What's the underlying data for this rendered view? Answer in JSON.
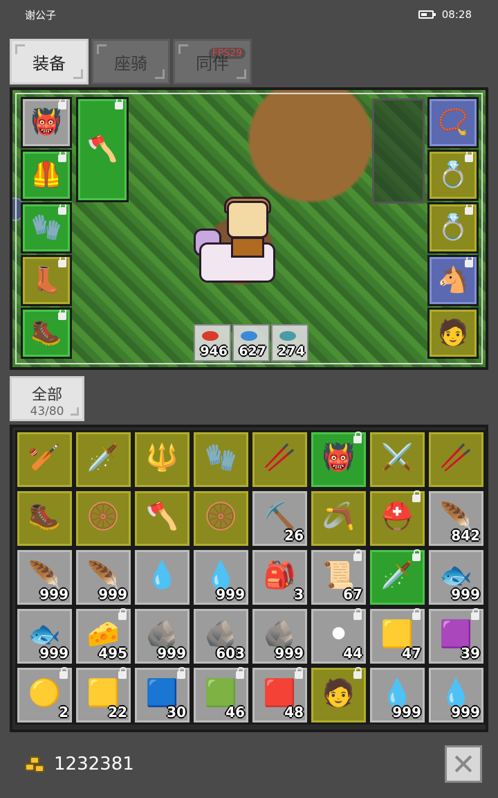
{
  "status_bar": {
    "title": "谢公子",
    "time": "08:28",
    "battery_icon": "battery-icon"
  },
  "tabs": [
    {
      "label": "装备",
      "active": true
    },
    {
      "label": "座骑",
      "active": false
    },
    {
      "label": "同伴",
      "active": false
    }
  ],
  "fps_label": "FPS29",
  "equipment_left": [
    {
      "name": "horned-helmet",
      "icon": "👹",
      "color": "gray",
      "locked": true
    },
    {
      "name": "brown-armor",
      "icon": "🦺",
      "color": "green",
      "locked": true
    },
    {
      "name": "purple-gloves",
      "icon": "🧤",
      "color": "green",
      "locked": true
    },
    {
      "name": "red-boots",
      "icon": "👢",
      "color": "yellow",
      "locked": true
    },
    {
      "name": "dark-boots",
      "icon": "🥾",
      "color": "green",
      "locked": true
    }
  ],
  "weapon_slot": {
    "name": "golden-axe",
    "icon": "🪓",
    "color": "green",
    "locked": true
  },
  "equipment_right": [
    {
      "name": "silver-amulet",
      "icon": "📿",
      "color": "blue",
      "locked": false
    },
    {
      "name": "gold-ring-1",
      "icon": "💍",
      "color": "yellow",
      "locked": true
    },
    {
      "name": "gold-ring-2",
      "icon": "💍",
      "color": "yellow",
      "locked": true
    },
    {
      "name": "horse-mount",
      "icon": "🐴",
      "color": "blue",
      "locked": true
    },
    {
      "name": "companion-portrait",
      "icon": "🧑",
      "color": "yellow",
      "locked": false
    }
  ],
  "scene_resources": [
    {
      "count": "946",
      "color": "#d93a2a"
    },
    {
      "count": "627",
      "color": "#3a8ad9"
    },
    {
      "count": "274",
      "color": "#4a9aa8"
    }
  ],
  "filter": {
    "label": "全部",
    "count": "43/80"
  },
  "inventory": [
    {
      "icon": "🏏",
      "color": "yellow",
      "count": "",
      "locked": false
    },
    {
      "icon": "🗡️",
      "color": "yellow",
      "count": "",
      "locked": false
    },
    {
      "icon": "🔱",
      "color": "yellow",
      "count": "",
      "locked": false
    },
    {
      "icon": "🧤",
      "color": "yellow",
      "count": "",
      "locked": false
    },
    {
      "icon": "🥢",
      "color": "yellow",
      "count": "",
      "locked": false
    },
    {
      "icon": "👹",
      "color": "green",
      "count": "",
      "locked": true
    },
    {
      "icon": "⚔️",
      "color": "yellow",
      "count": "",
      "locked": false
    },
    {
      "icon": "🥢",
      "color": "yellow",
      "count": "",
      "locked": false
    },
    {
      "icon": "🥾",
      "color": "yellow",
      "count": "",
      "locked": false
    },
    {
      "icon": "🛞",
      "color": "yellow",
      "count": "",
      "locked": false
    },
    {
      "icon": "🪓",
      "color": "yellow",
      "count": "",
      "locked": false
    },
    {
      "icon": "🛞",
      "color": "yellow",
      "count": "",
      "locked": false
    },
    {
      "icon": "⛏️",
      "color": "gray",
      "count": "26",
      "locked": false
    },
    {
      "icon": "🪃",
      "color": "yellow",
      "count": "",
      "locked": false
    },
    {
      "icon": "⛑️",
      "color": "yellow",
      "count": "",
      "locked": true
    },
    {
      "icon": "🪶",
      "color": "gray",
      "count": "842",
      "locked": false
    },
    {
      "icon": "🪶",
      "color": "gray",
      "count": "999",
      "locked": false
    },
    {
      "icon": "🪶",
      "color": "gray",
      "count": "999",
      "locked": false
    },
    {
      "icon": "💧",
      "color": "gray",
      "count": "",
      "locked": false
    },
    {
      "icon": "💧",
      "color": "gray",
      "count": "999",
      "locked": false
    },
    {
      "icon": "🎒",
      "color": "gray",
      "count": "3",
      "locked": false
    },
    {
      "icon": "📜",
      "color": "gray",
      "count": "67",
      "locked": true
    },
    {
      "icon": "🗡️",
      "color": "green",
      "count": "",
      "locked": true
    },
    {
      "icon": "🐟",
      "color": "gray",
      "count": "999",
      "locked": false
    },
    {
      "icon": "🐟",
      "color": "gray",
      "count": "999",
      "locked": false
    },
    {
      "icon": "🧀",
      "color": "gray",
      "count": "495",
      "locked": true
    },
    {
      "icon": "🪨",
      "color": "gray",
      "count": "999",
      "locked": false
    },
    {
      "icon": "🪨",
      "color": "gray",
      "count": "603",
      "locked": false
    },
    {
      "icon": "🪨",
      "color": "gray",
      "count": "999",
      "locked": false
    },
    {
      "icon": "⚫",
      "color": "gray",
      "count": "44",
      "locked": true
    },
    {
      "icon": "🟨",
      "color": "gray",
      "count": "47",
      "locked": true
    },
    {
      "icon": "🟪",
      "color": "gray",
      "count": "39",
      "locked": true
    },
    {
      "icon": "🟡",
      "color": "gray",
      "count": "2",
      "locked": true
    },
    {
      "icon": "🟨",
      "color": "gray",
      "count": "22",
      "locked": true
    },
    {
      "icon": "🟦",
      "color": "gray",
      "count": "30",
      "locked": true
    },
    {
      "icon": "🟩",
      "color": "gray",
      "count": "46",
      "locked": true
    },
    {
      "icon": "🟥",
      "color": "gray",
      "count": "48",
      "locked": true
    },
    {
      "icon": "🧑",
      "color": "yellow",
      "count": "",
      "locked": true
    },
    {
      "icon": "💧",
      "color": "gray",
      "count": "999",
      "locked": false
    },
    {
      "icon": "💧",
      "color": "gray",
      "count": "999",
      "locked": false
    }
  ],
  "gold": {
    "amount": "1232381",
    "icon": "gold-nugget-icon"
  },
  "close_button": {
    "icon": "close-icon",
    "glyph": "✕"
  }
}
